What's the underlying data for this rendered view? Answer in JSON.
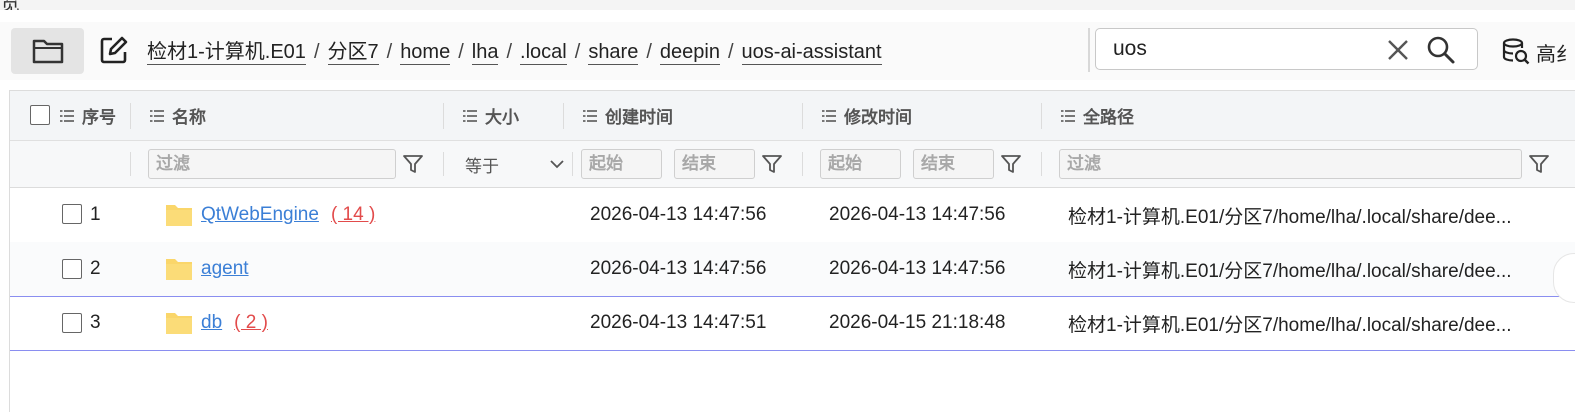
{
  "top_cut_text": "览",
  "toolbar": {
    "breadcrumb": [
      "检材1-计算机.E01",
      "分区7",
      "home",
      "lha",
      ".local",
      "share",
      "deepin",
      "uos-ai-assistant"
    ],
    "separator": "/",
    "search": {
      "value": "uos"
    },
    "advanced_search_label": "高纟"
  },
  "columns": {
    "index": "序号",
    "name": "名称",
    "size": "大小",
    "created": "创建时间",
    "modified": "修改时间",
    "fullpath": "全路径"
  },
  "filters": {
    "name_placeholder": "过滤",
    "size_operator": "等于",
    "created_start": "起始",
    "created_end": "结束",
    "modified_start": "起始",
    "modified_end": "结束",
    "path_placeholder": "过滤"
  },
  "rows": [
    {
      "index": "1",
      "name": "QtWebEngine",
      "count": "( 14 )",
      "created": "2026-04-13 14:47:56",
      "modified": "2026-04-13 14:47:56",
      "path": "检材1-计算机.E01/分区7/home/lha/.local/share/dee..."
    },
    {
      "index": "2",
      "name": "agent",
      "count": "",
      "created": "2026-04-13 14:47:56",
      "modified": "2026-04-13 14:47:56",
      "path": "检材1-计算机.E01/分区7/home/lha/.local/share/dee..."
    },
    {
      "index": "3",
      "name": "db",
      "count": "( 2 )",
      "created": "2026-04-13 14:47:51",
      "modified": "2026-04-15 21:18:48",
      "path": "检材1-计算机.E01/分区7/home/lha/.local/share/dee..."
    }
  ],
  "icons": {
    "folder_button": "folder-outline-icon",
    "edit": "edit-path-icon",
    "clear": "close-icon",
    "search": "search-icon",
    "advanced": "database-search-icon",
    "column": "list-icon",
    "filter": "funnel-icon",
    "row_folder": "folder-icon"
  },
  "colors": {
    "link": "#3b7fd6",
    "count": "#e24b4b",
    "folder": "#fad66a",
    "row_divider_selected": "#8a8ef0"
  }
}
